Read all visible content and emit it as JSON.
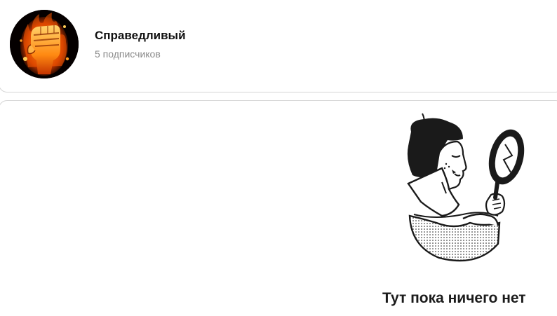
{
  "channel": {
    "name": "Справедливый",
    "subscribers": "5 подписчиков",
    "avatar_icon": "flaming-fist-icon"
  },
  "feed": {
    "empty_message": "Тут пока ничего нет",
    "illustration_icon": "person-with-mirror-illustration"
  },
  "colors": {
    "text_primary": "#111111",
    "text_secondary": "#8a8a8a",
    "border": "#d6d6d6",
    "avatar_fire": "#ff7a00",
    "illustration_ink": "#1a1a1a"
  }
}
